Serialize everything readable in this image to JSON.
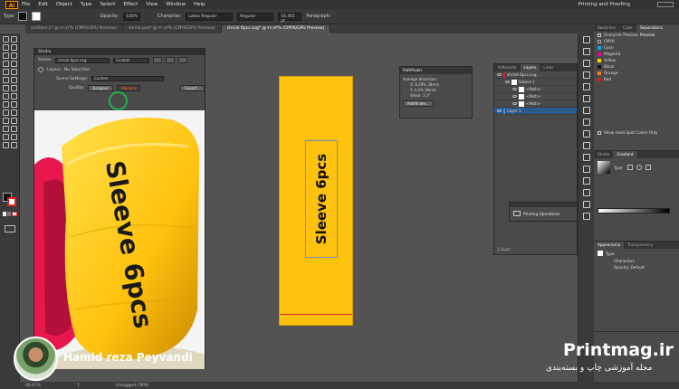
{
  "app": {
    "logo": "Ai",
    "workspace": "Printing and Proofing"
  },
  "menu": [
    "File",
    "Edit",
    "Object",
    "Type",
    "Select",
    "Effect",
    "View",
    "Window",
    "Help"
  ],
  "control_bar": {
    "type_label": "Type",
    "opacity_label": "Opacity:",
    "opacity_value": "100%",
    "character_label": "Character:",
    "font_value": "Lateo Regular",
    "style_value": "Regular",
    "size_value": "16.461 pt",
    "paragraph_label": "Paragraph:"
  },
  "doc_tabs": [
    {
      "label": "Untitled-1* @ ۲۶,۷۳% (CMYK/GPU Preview)",
      "active": false
    },
    {
      "label": "shrink.psd* @ ۲۶,۷۳% (CMYK/GPU Preview)",
      "active": false
    },
    {
      "label": "shrink 6pcs.svg* @ ۲۶,۷۳% (CMYK/GPU Preview)",
      "active": true
    }
  ],
  "studio": {
    "title": "Studio",
    "scene_label": "Scene:",
    "scene_value": "shrink 6pcs.svg",
    "custom_value": "Custom",
    "layers_label": "Layers",
    "no_selection": "No Selection",
    "scene_settings_label": "Scene Settings:",
    "scene_settings_value": "Custom",
    "quality_label": "Quality:",
    "quality_draft": "Designer",
    "quality_high": "Medium",
    "export_button": "Export..."
  },
  "artboard": {
    "text": "Sleeve 6pcs"
  },
  "preview_text": "Sleeve 6pcs",
  "pathfinder": {
    "title": "Pathfinder",
    "max_distortion": "Average distortion:",
    "x_value": "X: 0.29% 38mm",
    "y_value": "Y: 0.4% 36mm",
    "shear_value": "Shear: 2.3°",
    "button": "Pathfinder..."
  },
  "layers_panel": {
    "tabs": [
      "Artboards",
      "Layers",
      "Links"
    ],
    "rows": [
      "shrink 6pcs.svg",
      "Sleeve 1",
      "<Path>",
      "<Path>",
      "<Path>",
      "Layer 1"
    ],
    "footer": "1 Layer"
  },
  "printing_ops": {
    "label": "Printing Operations"
  },
  "right_panels": {
    "tabs_top": [
      "Swatches",
      "Color",
      "Separations Preview"
    ],
    "overprint_label": "Overprint Preview",
    "separations": [
      {
        "name": "CMYK",
        "color": "#ffffff"
      },
      {
        "name": "Cyan",
        "color": "#00aeef"
      },
      {
        "name": "Magenta",
        "color": "#ec008c"
      },
      {
        "name": "Yellow",
        "color": "#ffd400"
      },
      {
        "name": "Black",
        "color": "#111111"
      },
      {
        "name": "Orange",
        "color": "#f47b20"
      },
      {
        "name": "Red",
        "color": "#d21f26"
      }
    ],
    "sep_footer": "Show Used Spot Colors Only",
    "gradient_tabs": [
      "Stroke",
      "Gradient"
    ],
    "gradient_type_label": "Type:",
    "appearance_tabs": [
      "Appearance",
      "Transparency"
    ],
    "appearance_title": "Type",
    "appearance_characters": "Characters",
    "appearance_opacity": "Opacity: Default"
  },
  "status": {
    "zoom": "66.67%",
    "artboard": "1",
    "color_profile": "Untagged CMYK"
  },
  "author": {
    "name": "Hamid reza Peyvandi"
  },
  "brand": {
    "logo": "Printmag.ir",
    "subtitle": "مجله آموزشی چاپ و بسته‌بندی"
  }
}
